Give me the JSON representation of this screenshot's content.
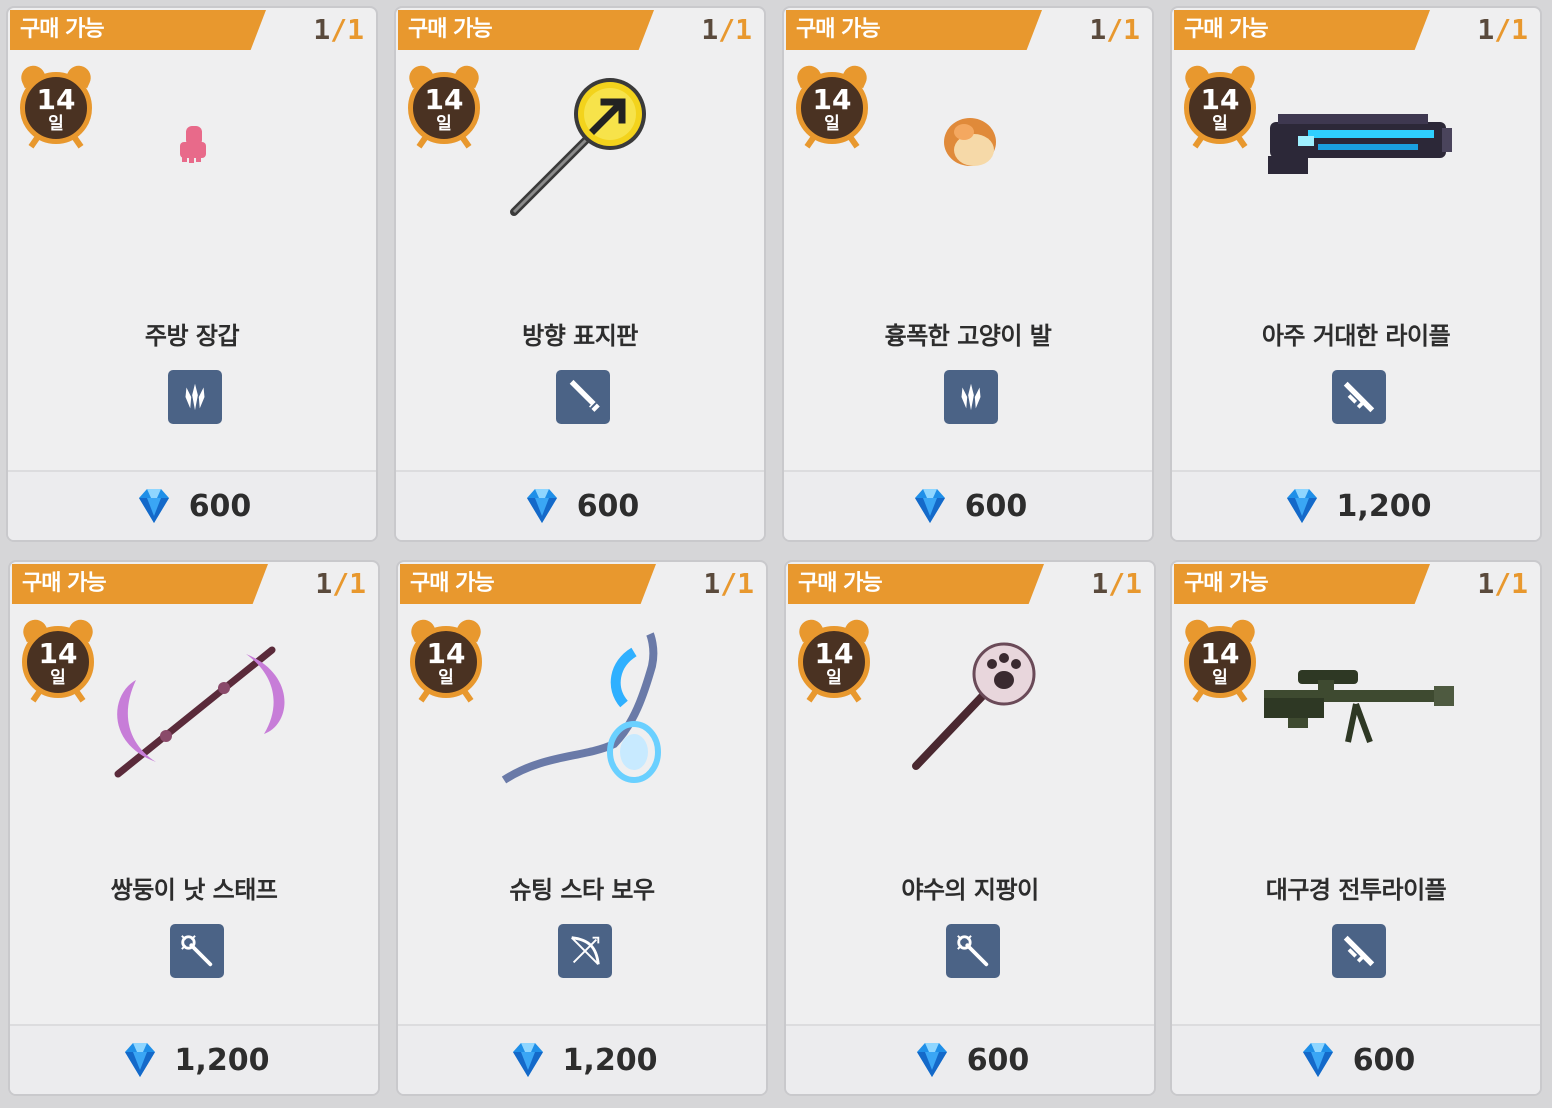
{
  "tag_label": "구매 가능",
  "stock": {
    "current": "1",
    "sep": "/",
    "max": "1"
  },
  "duration": {
    "days": "14",
    "unit": "일"
  },
  "colors": {
    "tag": "#e8982e",
    "type_bg": "#4b6386",
    "clock_face": "#4a3222"
  },
  "items": [
    {
      "name": "주방 장갑",
      "price": "600",
      "type_icon": "claw-icon",
      "art": "pink-glove"
    },
    {
      "name": "방향 표지판",
      "price": "600",
      "type_icon": "sword-icon",
      "art": "arrow-sign"
    },
    {
      "name": "흉폭한 고양이 발",
      "price": "600",
      "type_icon": "claw-icon",
      "art": "cat-paw"
    },
    {
      "name": "아주 거대한 라이플",
      "price": "1,200",
      "type_icon": "rifle-icon",
      "art": "giant-rifle"
    },
    {
      "name": "쌍둥이 낫 스태프",
      "price": "1,200",
      "type_icon": "staff-icon",
      "art": "twin-scythe"
    },
    {
      "name": "슈팅 스타 보우",
      "price": "1,200",
      "type_icon": "bow-icon",
      "art": "star-bow"
    },
    {
      "name": "야수의 지팡이",
      "price": "600",
      "type_icon": "staff-icon",
      "art": "beast-staff"
    },
    {
      "name": "대구경 전투라이플",
      "price": "600",
      "type_icon": "rifle-icon",
      "art": "sniper-rifle"
    }
  ]
}
